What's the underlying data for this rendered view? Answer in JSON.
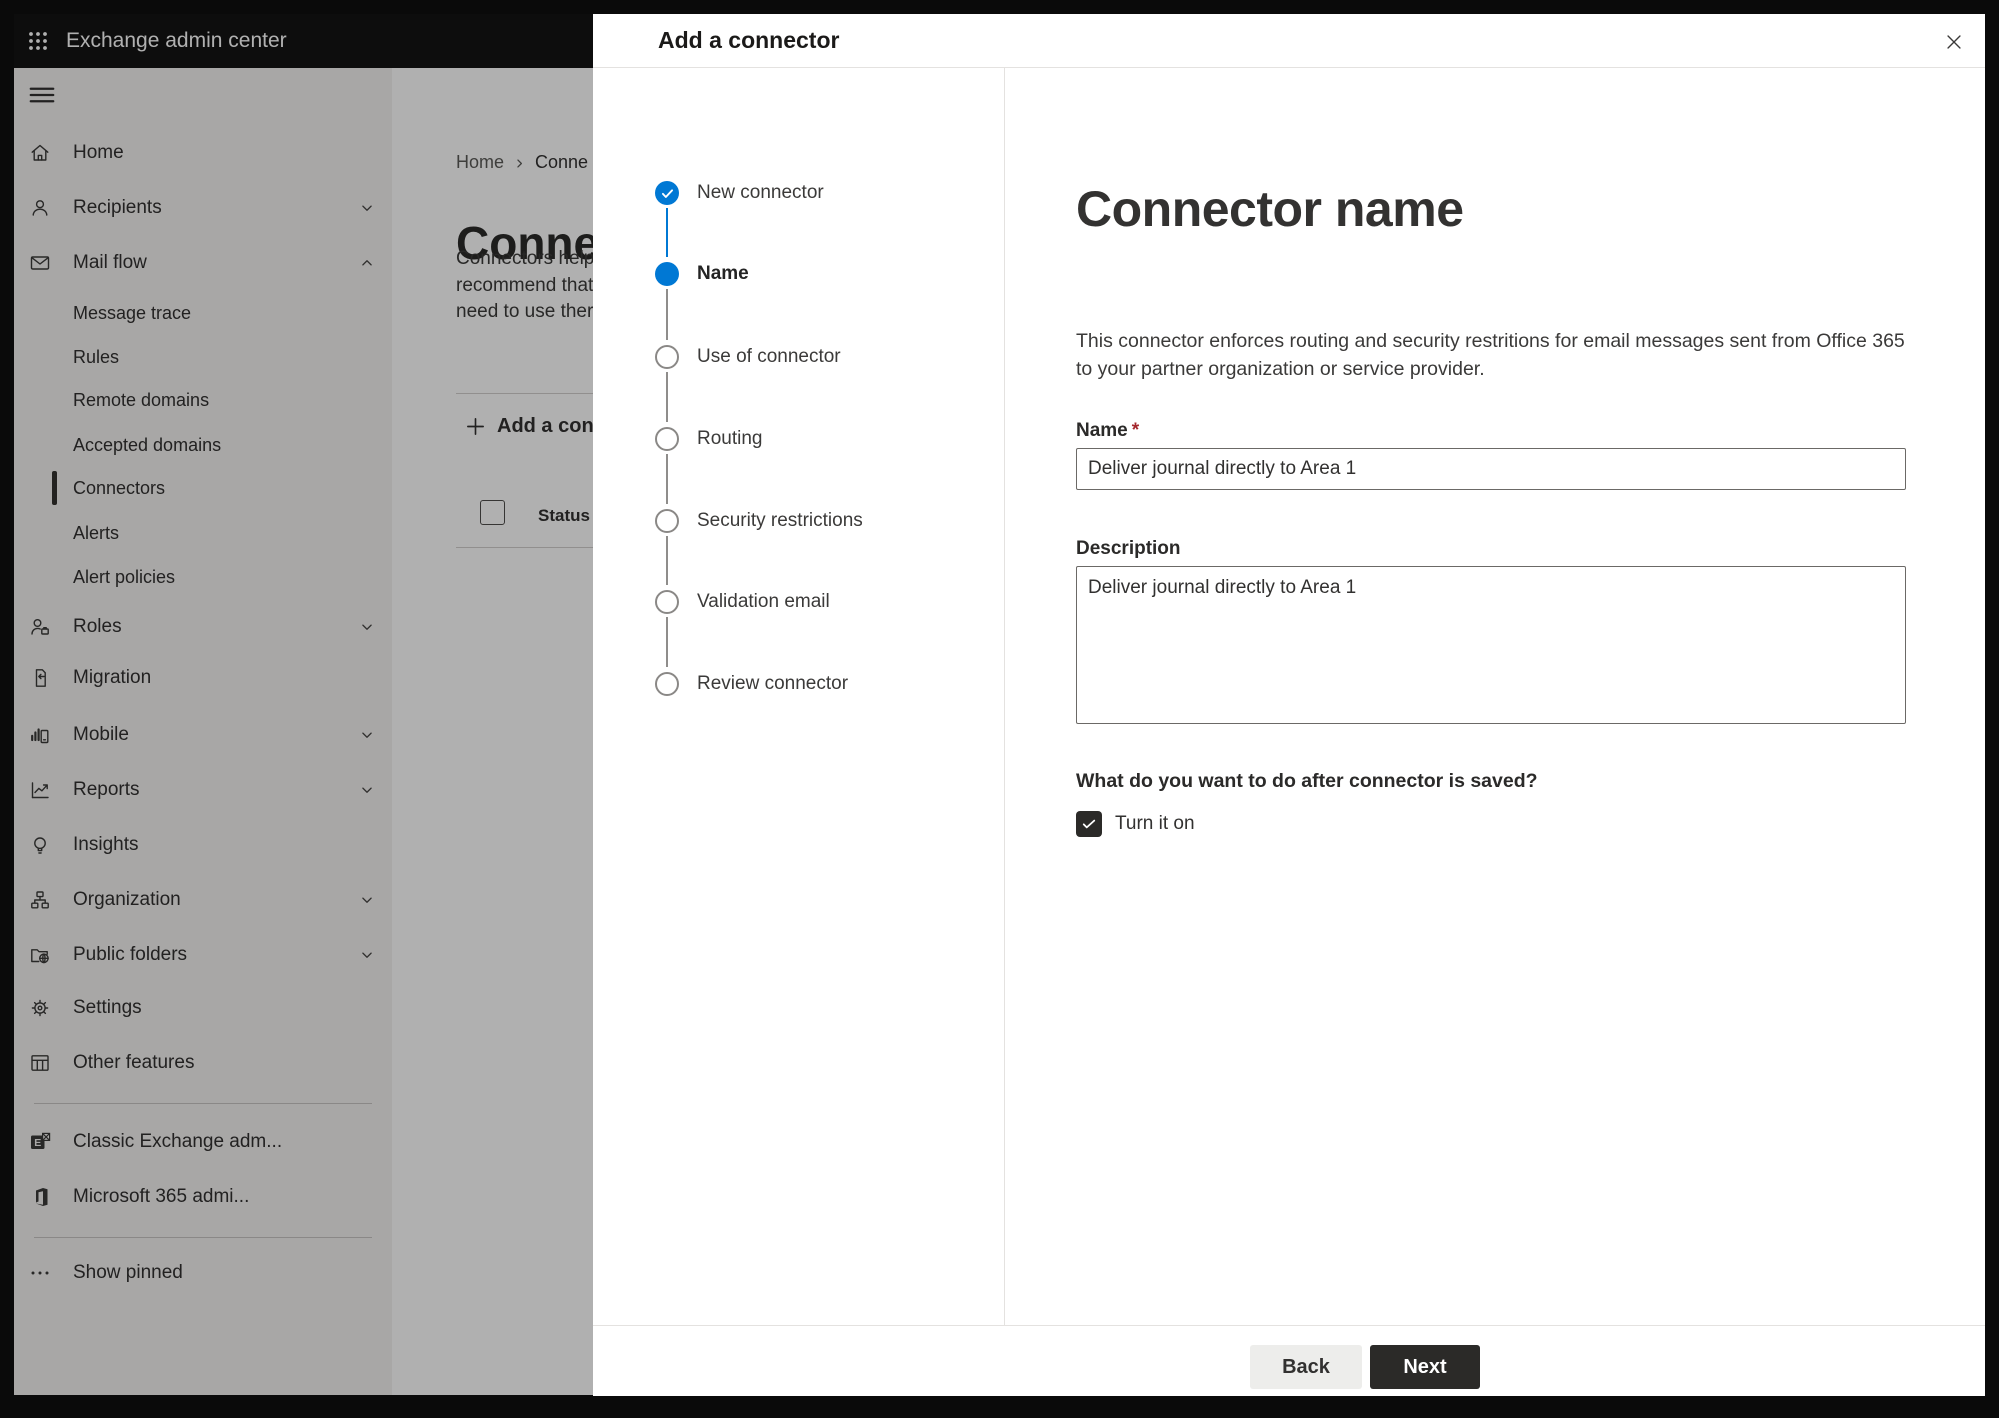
{
  "app_bar": {
    "title": "Exchange admin center"
  },
  "sidebar": {
    "items": [
      {
        "label": "Home"
      },
      {
        "label": "Recipients",
        "expandable": true
      },
      {
        "label": "Mail flow",
        "expandable": true,
        "expanded": true
      },
      {
        "label": "Roles",
        "expandable": true
      },
      {
        "label": "Migration"
      },
      {
        "label": "Mobile",
        "expandable": true
      },
      {
        "label": "Reports",
        "expandable": true
      },
      {
        "label": "Insights"
      },
      {
        "label": "Organization",
        "expandable": true
      },
      {
        "label": "Public folders",
        "expandable": true
      },
      {
        "label": "Settings"
      },
      {
        "label": "Other features"
      }
    ],
    "mail_flow_children": [
      {
        "label": "Message trace"
      },
      {
        "label": "Rules"
      },
      {
        "label": "Remote domains"
      },
      {
        "label": "Accepted domains"
      },
      {
        "label": "Connectors",
        "selected": true
      },
      {
        "label": "Alerts"
      },
      {
        "label": "Alert policies"
      }
    ],
    "footer_items": [
      {
        "label": "Classic Exchange adm..."
      },
      {
        "label": "Microsoft 365 admi..."
      },
      {
        "label": "Show pinned"
      }
    ]
  },
  "background_page": {
    "breadcrumb": {
      "home": "Home",
      "current": "Conne"
    },
    "title": "Connec",
    "intro_lines": [
      "Connectors help",
      "recommend that",
      "need to use ther"
    ],
    "add_connector_button": "Add a conn",
    "table": {
      "status_column": "Status"
    }
  },
  "modal": {
    "title": "Add a connector",
    "steps": [
      {
        "label": "New connector",
        "state": "completed"
      },
      {
        "label": "Name",
        "state": "current"
      },
      {
        "label": "Use of connector",
        "state": "upcoming"
      },
      {
        "label": "Routing",
        "state": "upcoming"
      },
      {
        "label": "Security restrictions",
        "state": "upcoming"
      },
      {
        "label": "Validation email",
        "state": "upcoming"
      },
      {
        "label": "Review connector",
        "state": "upcoming"
      }
    ],
    "content": {
      "heading": "Connector name",
      "description": "This connector enforces routing and security restritions for email messages sent from Office 365 to your partner organization or service provider.",
      "name_label": "Name",
      "required_marker": "*",
      "name_value": "Deliver journal directly to Area 1",
      "description_label": "Description",
      "description_value": "Deliver journal directly to Area 1",
      "after_save_question": "What do you want to do after connector is saved?",
      "turn_it_on_label": "Turn it on",
      "turn_it_on_checked": true
    },
    "footer": {
      "back": "Back",
      "next": "Next"
    }
  },
  "colors": {
    "accent": "#0078d4",
    "nextbtn": "#2b2a28",
    "checkbox": "#2b2a28",
    "required": "#a4262c"
  }
}
